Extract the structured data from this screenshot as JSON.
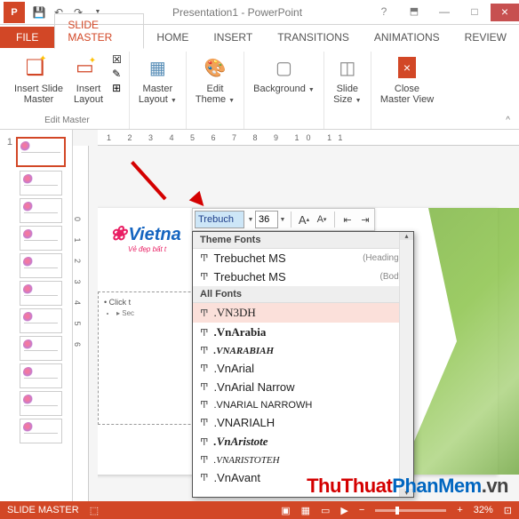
{
  "title": "Presentation1 - PowerPoint",
  "tabs": {
    "file": "FILE",
    "slide_master": "SLIDE MASTER",
    "home": "HOME",
    "insert": "INSERT",
    "transitions": "TRANSITIONS",
    "animations": "ANIMATIONS",
    "review": "REVIEW"
  },
  "ribbon": {
    "insert_slide_master": "Insert Slide\nMaster",
    "insert_layout": "Insert\nLayout",
    "master_layout": "Master\nLayout",
    "edit_theme": "Edit\nTheme",
    "background": "Background",
    "slide_size": "Slide\nSize",
    "close_master_view": "Close\nMaster View",
    "group_edit_master": "Edit Master"
  },
  "ruler_h": "1   2   3   4   5   6   7   8   9   10  11",
  "ruler_v": "0 1 2 3 4 5 6",
  "slide": {
    "logo": "Vietna",
    "logo_sub": "Vẻ đẹp bất t",
    "placeholder_title": "Click t",
    "placeholder_bullet": "Sec"
  },
  "mini": {
    "font_name": "Trebuch",
    "font_size": "36",
    "grow": "A",
    "shrink": "A"
  },
  "dropdown": {
    "theme_header": "Theme Fonts",
    "theme_fonts": [
      {
        "name": "Trebuchet MS",
        "tag": "(Headings)"
      },
      {
        "name": "Trebuchet MS",
        "tag": "(Body)"
      }
    ],
    "all_header": "All Fonts",
    "all_fonts": [
      ".VN3DH",
      ".VnArabia",
      ".VNARABIAH",
      ".VnArial",
      ".VnArial Narrow",
      ".VNARIAL NARROWH",
      ".VNARIALH",
      ".VnAristote",
      ".VNARISTOTEH",
      ".VnAvant"
    ]
  },
  "watermark": {
    "p1": "Thu",
    "p2": "Thuat",
    "p3": "Phan",
    "p4": "Mem",
    "p5": ".vn"
  },
  "status": {
    "mode": "SLIDE MASTER",
    "zoom": "32%",
    "plus": "+"
  },
  "thumb_num": "1"
}
